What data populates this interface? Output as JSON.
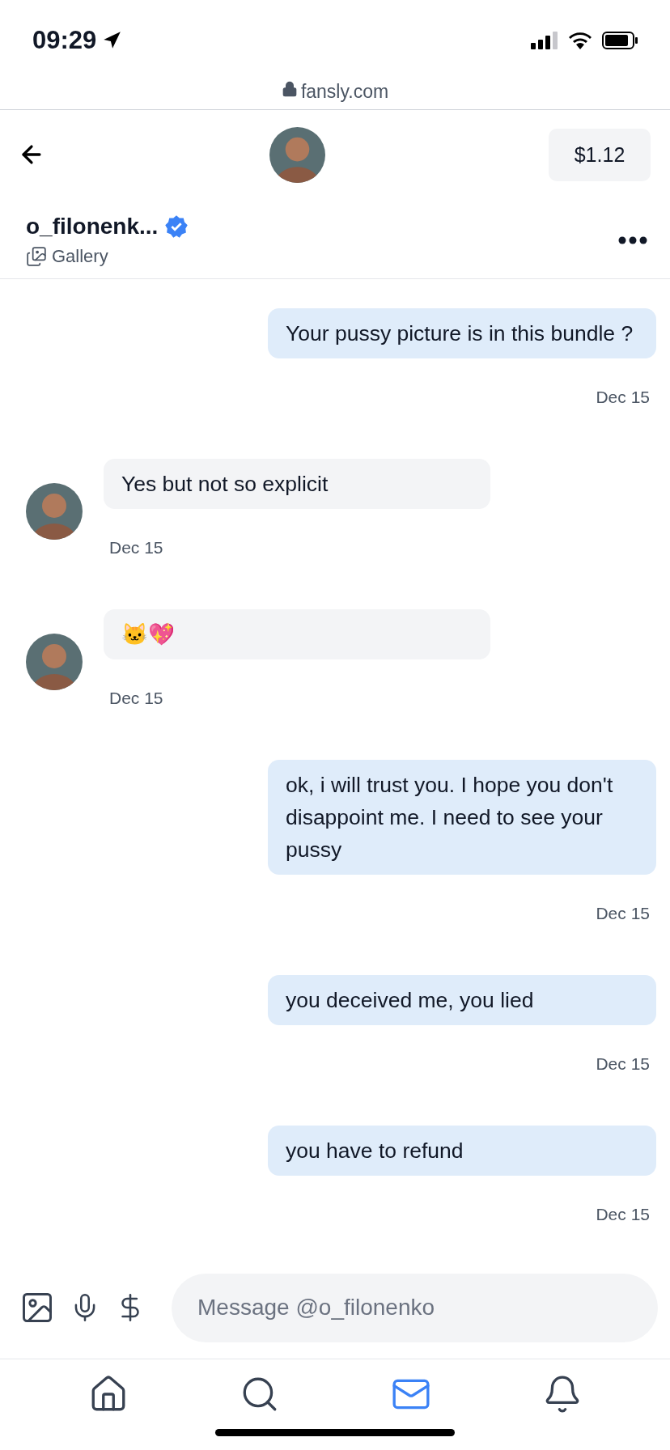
{
  "status_bar": {
    "time": "09:29"
  },
  "browser": {
    "url": "fansly.com"
  },
  "header": {
    "balance": "$1.12",
    "username": "o_filonenk...",
    "subtitle": "Gallery"
  },
  "messages": [
    {
      "kind": "sent",
      "text": "Your pussy picture is in this bundle ?",
      "date": "Dec 15"
    },
    {
      "kind": "received",
      "text": "Yes but not so explicit",
      "date": "Dec 15"
    },
    {
      "kind": "received",
      "text": "🐱💖",
      "date": "Dec 15"
    },
    {
      "kind": "sent",
      "text": "ok, i will trust you. I hope you don't disappoint me. I need to see your pussy",
      "date": "Dec 15"
    },
    {
      "kind": "sent",
      "text": "you deceived me, you lied",
      "date": "Dec 15"
    },
    {
      "kind": "sent",
      "text": " you have to refund",
      "date": "Dec 15"
    }
  ],
  "compose": {
    "placeholder": "Message @o_filonenko"
  },
  "nav": [
    {
      "kind": "home",
      "selected": false
    },
    {
      "kind": "search",
      "selected": false
    },
    {
      "kind": "messages",
      "selected": true
    },
    {
      "kind": "notifications",
      "selected": false
    }
  ]
}
